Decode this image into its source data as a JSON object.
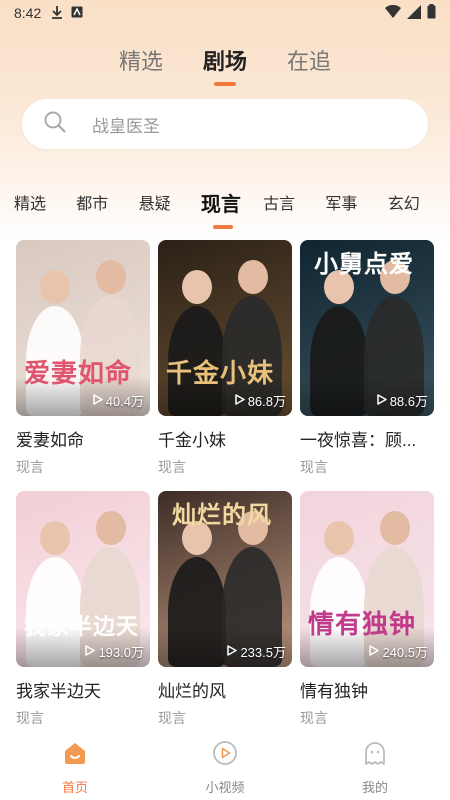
{
  "status": {
    "time": "8:42"
  },
  "top_tabs": [
    {
      "label": "精选"
    },
    {
      "label": "剧场",
      "active": true
    },
    {
      "label": "在追"
    }
  ],
  "search": {
    "placeholder": "战皇医圣"
  },
  "categories": [
    {
      "label": "精选"
    },
    {
      "label": "都市"
    },
    {
      "label": "悬疑"
    },
    {
      "label": "现言",
      "active": true
    },
    {
      "label": "古言"
    },
    {
      "label": "军事"
    },
    {
      "label": "玄幻"
    }
  ],
  "dramas": [
    {
      "title": "爱妻如命",
      "tag": "现言",
      "views": "40.4万",
      "poster_text": "爱妻如命",
      "colors": [
        "#d8c9c0",
        "#efe3dc"
      ],
      "accent": "#e0556d"
    },
    {
      "title": "千金小妹",
      "tag": "现言",
      "views": "86.8万",
      "poster_text": "千金小妹",
      "colors": [
        "#2b2118",
        "#6a5030"
      ],
      "accent": "#e8c07a"
    },
    {
      "title": "一夜惊喜：顾...",
      "tag": "现言",
      "views": "88.6万",
      "poster_text": "",
      "poster_top_text": "小舅点爱",
      "colors": [
        "#0f2430",
        "#3b5560"
      ],
      "accent": "#ffffff"
    },
    {
      "title": "我家半边天",
      "tag": "现言",
      "views": "193.0万",
      "poster_text": "我家半边天",
      "colors": [
        "#f1cfd6",
        "#fbe9ee"
      ],
      "accent": "#ffffff"
    },
    {
      "title": "灿烂的风",
      "tag": "现言",
      "views": "233.5万",
      "poster_text": "",
      "poster_top_text": "灿烂的风",
      "colors": [
        "#3d2c26",
        "#c09a80"
      ],
      "accent": "#f2d9a0"
    },
    {
      "title": "情有独钟",
      "tag": "现言",
      "views": "240.5万",
      "poster_text": "情有独钟",
      "colors": [
        "#f2d4dc",
        "#f7e4ea"
      ],
      "accent": "#c23a8a"
    }
  ],
  "bottom_nav": [
    {
      "label": "首页",
      "icon": "home-icon",
      "active": true
    },
    {
      "label": "小视频",
      "icon": "play-circle-icon"
    },
    {
      "label": "我的",
      "icon": "profile-ghost-icon"
    }
  ],
  "colors": {
    "accent": "#f07a3e",
    "inactive": "#888888"
  }
}
